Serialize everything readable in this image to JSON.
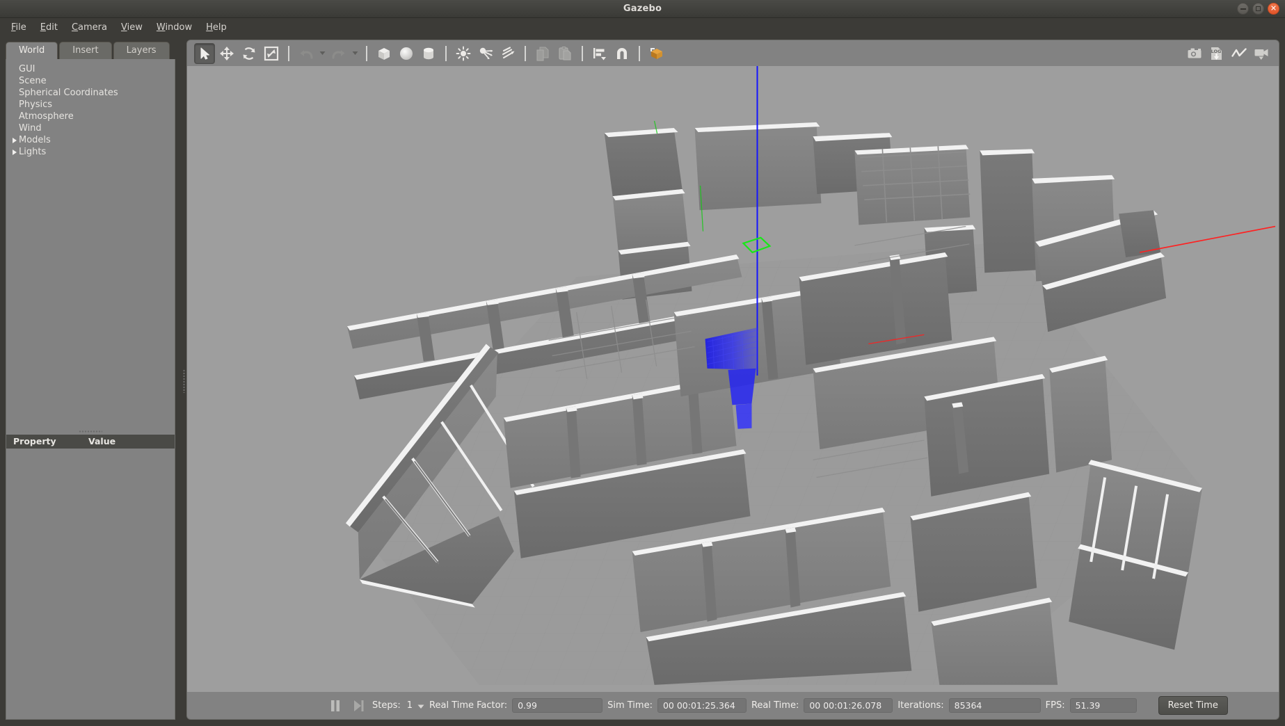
{
  "window": {
    "title": "Gazebo",
    "controls": [
      {
        "name": "minimize",
        "glyph": "–"
      },
      {
        "name": "maximize",
        "glyph": "□"
      },
      {
        "name": "close",
        "glyph": "✕"
      }
    ]
  },
  "menubar": {
    "items": [
      {
        "label": "File",
        "mnemonic": "F"
      },
      {
        "label": "Edit",
        "mnemonic": "E"
      },
      {
        "label": "Camera",
        "mnemonic": "C"
      },
      {
        "label": "View",
        "mnemonic": "V"
      },
      {
        "label": "Window",
        "mnemonic": "W"
      },
      {
        "label": "Help",
        "mnemonic": "H"
      }
    ]
  },
  "left_panel": {
    "tabs": [
      {
        "label": "World",
        "active": true
      },
      {
        "label": "Insert",
        "active": false
      },
      {
        "label": "Layers",
        "active": false
      }
    ],
    "tree": [
      {
        "label": "GUI",
        "expandable": false
      },
      {
        "label": "Scene",
        "expandable": false
      },
      {
        "label": "Spherical Coordinates",
        "expandable": false
      },
      {
        "label": "Physics",
        "expandable": false
      },
      {
        "label": "Atmosphere",
        "expandable": false
      },
      {
        "label": "Wind",
        "expandable": false
      },
      {
        "label": "Models",
        "expandable": true
      },
      {
        "label": "Lights",
        "expandable": true
      }
    ],
    "property_table": {
      "columns": [
        "Property",
        "Value"
      ],
      "rows": []
    }
  },
  "toolbar": {
    "left_tools": [
      {
        "name": "select-mode",
        "label": "Selection Mode",
        "icon": "cursor-arrow-icon",
        "active": true
      },
      {
        "name": "translate-mode",
        "label": "Translation Mode",
        "icon": "move-arrows-icon",
        "active": false
      },
      {
        "name": "rotate-mode",
        "label": "Rotation Mode",
        "icon": "rotate-icon",
        "active": false
      },
      {
        "name": "scale-mode",
        "label": "Scale Mode",
        "icon": "scale-icon",
        "active": false
      }
    ],
    "history_tools": [
      {
        "name": "undo",
        "label": "Undo",
        "icon": "undo-arrow-icon",
        "disabled": true
      },
      {
        "name": "redo",
        "label": "Redo",
        "icon": "redo-arrow-icon",
        "disabled": true
      }
    ],
    "shape_tools": [
      {
        "name": "insert-box",
        "label": "Box",
        "icon": "box-icon"
      },
      {
        "name": "insert-sphere",
        "label": "Sphere",
        "icon": "sphere-icon"
      },
      {
        "name": "insert-cylinder",
        "label": "Cylinder",
        "icon": "cylinder-icon"
      }
    ],
    "light_tools": [
      {
        "name": "insert-point-light",
        "label": "Point Light",
        "icon": "point-light-icon"
      },
      {
        "name": "insert-spot-light",
        "label": "Spot Light",
        "icon": "spot-light-icon"
      },
      {
        "name": "insert-directional-light",
        "label": "Directional Light",
        "icon": "directional-light-icon"
      }
    ],
    "clipboard_tools": [
      {
        "name": "copy",
        "label": "Copy",
        "icon": "copy-icon",
        "disabled": true
      },
      {
        "name": "paste",
        "label": "Paste",
        "icon": "paste-icon",
        "disabled": true
      }
    ],
    "align_tools": [
      {
        "name": "align",
        "label": "Align",
        "icon": "align-icon"
      },
      {
        "name": "snap",
        "label": "Snap",
        "icon": "magnet-icon"
      }
    ],
    "view_tools": [
      {
        "name": "change-view",
        "label": "Change View",
        "icon": "view-cube-icon"
      }
    ],
    "right_tools": [
      {
        "name": "screenshot",
        "label": "Take Screenshot",
        "icon": "camera-icon"
      },
      {
        "name": "log-record",
        "label": "Log Data",
        "icon": "log-download-icon"
      },
      {
        "name": "plot",
        "label": "Plot Window",
        "icon": "line-chart-icon"
      },
      {
        "name": "video-record",
        "label": "Record Video",
        "icon": "video-camera-icon"
      }
    ]
  },
  "scene": {
    "background_color": "#9e9e9e",
    "wall_top_color": "#f2f2f2",
    "wall_face_dark": "#6f6f6f",
    "wall_face_mid": "#7c7c7c",
    "floor_color": "#9a9a9a",
    "axis_x_color": "#ff2020",
    "axis_z_color": "#2020ff",
    "selection_color": "#18e818",
    "laser_color": "#2222ee",
    "description": "3D indoor building floor plan with laser scan visualization"
  },
  "bottom_bar": {
    "pause_button": {
      "name": "pause",
      "icon": "pause-icon"
    },
    "step_button": {
      "name": "step",
      "icon": "step-forward-icon"
    },
    "steps_label": "Steps:",
    "steps_value": "1",
    "real_time_factor_label": "Real Time Factor:",
    "real_time_factor_value": "0.99",
    "sim_time_label": "Sim Time:",
    "sim_time_value": "00 00:01:25.364",
    "real_time_label": "Real Time:",
    "real_time_value": "00 00:01:26.078",
    "iterations_label": "Iterations:",
    "iterations_value": "85364",
    "fps_label": "FPS:",
    "fps_value": "51.39",
    "reset_time_label": "Reset Time"
  }
}
